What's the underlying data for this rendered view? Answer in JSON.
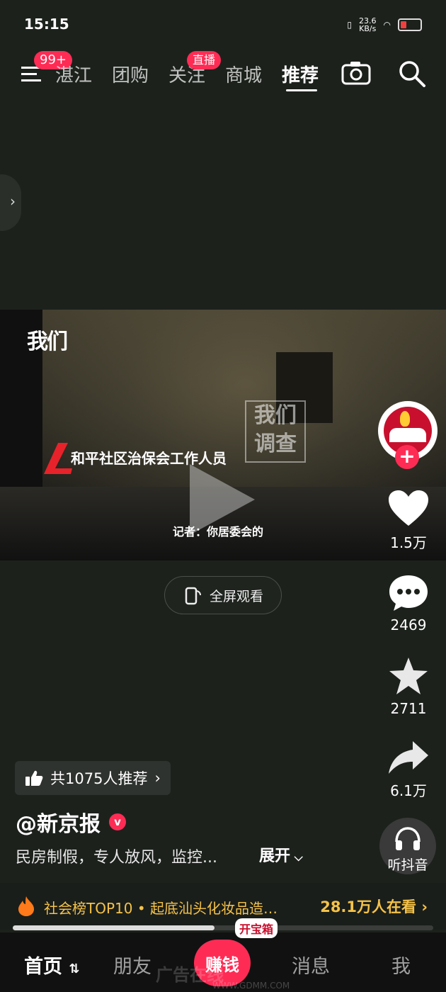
{
  "status_bar": {
    "time": "15:15",
    "net_speed": "23.6",
    "net_unit": "KB/s"
  },
  "top_nav": {
    "menu_badge": "99+",
    "tabs": [
      "湛江",
      "团购",
      "关注",
      "商城",
      "推荐"
    ],
    "follow_badge": "直播",
    "active_tab": "推荐"
  },
  "video": {
    "logo_text": "我们",
    "stamp_text": "我们调查",
    "caption": "和平社区治保会工作人员",
    "subtitle": "记者：你居委会的"
  },
  "fullscreen_label": "全屏观看",
  "rail": {
    "likes": "1.5万",
    "comments": "2469",
    "favorites": "2711",
    "shares": "6.1万",
    "listen_label": "听抖音"
  },
  "recommend": {
    "text": "共1075人推荐"
  },
  "author": {
    "name": "@新京报",
    "verified_mark": "v"
  },
  "description": {
    "text": "民房制假，专人放风，监控...",
    "expand_label": "展开"
  },
  "hot_bar": {
    "text": "社会榜TOP10 • 起底汕头化妆品造…",
    "viewers": "28.1万人在看"
  },
  "progress": 0.48,
  "tab_bar": {
    "home": "首页",
    "friends": "朋友",
    "earn": "赚钱",
    "treasure": "开宝箱",
    "messages": "消息",
    "me": "我",
    "watermark": "广告在线",
    "watermark_url": "WWW.GDMM.COM"
  },
  "colors": {
    "accent": "#fe2c55",
    "hot": "#f5c24a",
    "background": "#1c211c"
  }
}
